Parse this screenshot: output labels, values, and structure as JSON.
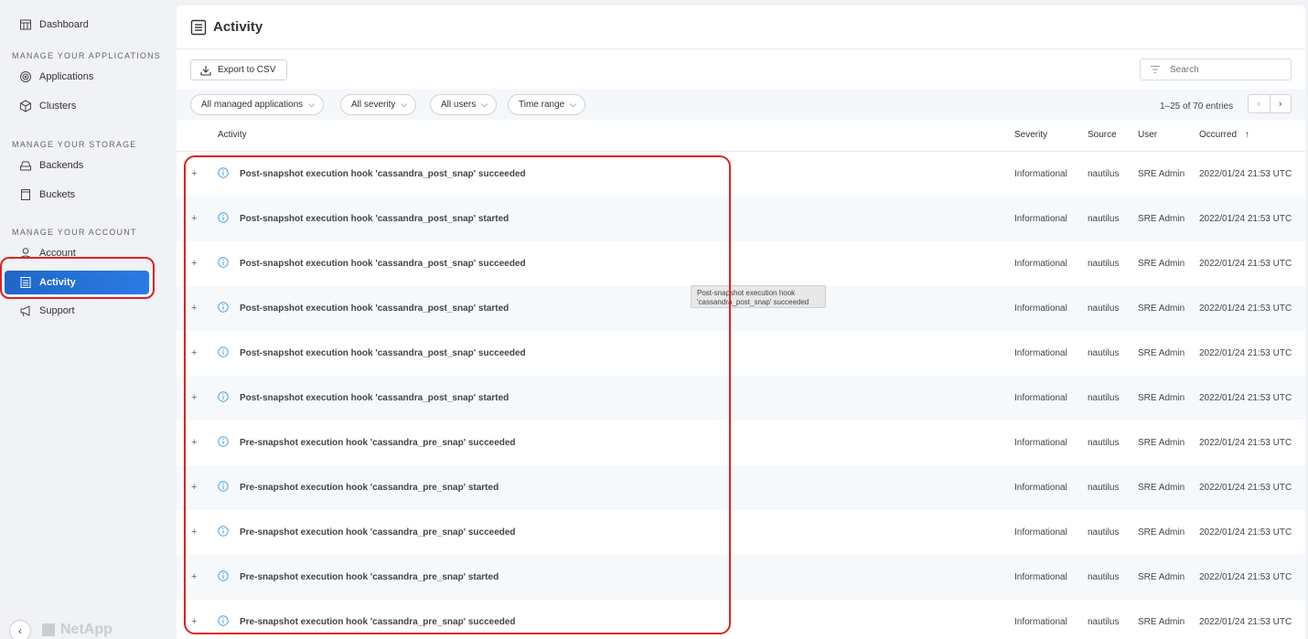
{
  "sidebar": {
    "items": {
      "dashboard": "Dashboard",
      "applications": "Applications",
      "clusters": "Clusters",
      "backends": "Backends",
      "buckets": "Buckets",
      "account": "Account",
      "activity": "Activity",
      "support": "Support"
    },
    "sections": {
      "apps": "MANAGE YOUR APPLICATIONS",
      "storage": "MANAGE YOUR STORAGE",
      "account": "MANAGE YOUR ACCOUNT"
    },
    "brand": "NetApp",
    "active": "Activity",
    "highlight_color": "#dd2222"
  },
  "page": {
    "title": "Activity",
    "export_label": "Export to CSV",
    "search_placeholder": "Search"
  },
  "filters": {
    "applications": "All managed applications",
    "severity": "All severity",
    "users": "All users",
    "time": "Time range"
  },
  "pager": {
    "range": "1–25",
    "of": "of",
    "total": "70",
    "entries_label": "entries"
  },
  "table": {
    "columns": {
      "activity": "Activity",
      "severity": "Severity",
      "source": "Source",
      "user": "User",
      "occurred": "Occurred"
    },
    "sort_indicator": "↑",
    "rows": [
      {
        "activity": "Post-snapshot execution hook 'cassandra_post_snap' succeeded",
        "severity": "Informational",
        "source": "nautilus",
        "user": "SRE Admin",
        "occurred": "2022/01/24 21:53 UTC"
      },
      {
        "activity": "Post-snapshot execution hook 'cassandra_post_snap' started",
        "severity": "Informational",
        "source": "nautilus",
        "user": "SRE Admin",
        "occurred": "2022/01/24 21:53 UTC"
      },
      {
        "activity": "Post-snapshot execution hook 'cassandra_post_snap' succeeded",
        "severity": "Informational",
        "source": "nautilus",
        "user": "SRE Admin",
        "occurred": "2022/01/24 21:53 UTC"
      },
      {
        "activity": "Post-snapshot execution hook 'cassandra_post_snap' started",
        "severity": "Informational",
        "source": "nautilus",
        "user": "SRE Admin",
        "occurred": "2022/01/24 21:53 UTC"
      },
      {
        "activity": "Post-snapshot execution hook 'cassandra_post_snap' succeeded",
        "severity": "Informational",
        "source": "nautilus",
        "user": "SRE Admin",
        "occurred": "2022/01/24 21:53 UTC"
      },
      {
        "activity": "Post-snapshot execution hook 'cassandra_post_snap' started",
        "severity": "Informational",
        "source": "nautilus",
        "user": "SRE Admin",
        "occurred": "2022/01/24 21:53 UTC"
      },
      {
        "activity": "Pre-snapshot execution hook 'cassandra_pre_snap' succeeded",
        "severity": "Informational",
        "source": "nautilus",
        "user": "SRE Admin",
        "occurred": "2022/01/24 21:53 UTC"
      },
      {
        "activity": "Pre-snapshot execution hook 'cassandra_pre_snap' started",
        "severity": "Informational",
        "source": "nautilus",
        "user": "SRE Admin",
        "occurred": "2022/01/24 21:53 UTC"
      },
      {
        "activity": "Pre-snapshot execution hook 'cassandra_pre_snap' succeeded",
        "severity": "Informational",
        "source": "nautilus",
        "user": "SRE Admin",
        "occurred": "2022/01/24 21:53 UTC"
      },
      {
        "activity": "Pre-snapshot execution hook 'cassandra_pre_snap' started",
        "severity": "Informational",
        "source": "nautilus",
        "user": "SRE Admin",
        "occurred": "2022/01/24 21:53 UTC"
      },
      {
        "activity": "Pre-snapshot execution hook 'cassandra_pre_snap' succeeded",
        "severity": "Informational",
        "source": "nautilus",
        "user": "SRE Admin",
        "occurred": "2022/01/24 21:53 UTC"
      }
    ]
  },
  "tooltip": {
    "line1": "Post-snapshot execution hook",
    "line2": "'cassandra_post_snap' succeeded"
  },
  "icons": {
    "expand": "plus-icon",
    "info": "info-circle-icon",
    "info_color": "#4aa3e0"
  }
}
